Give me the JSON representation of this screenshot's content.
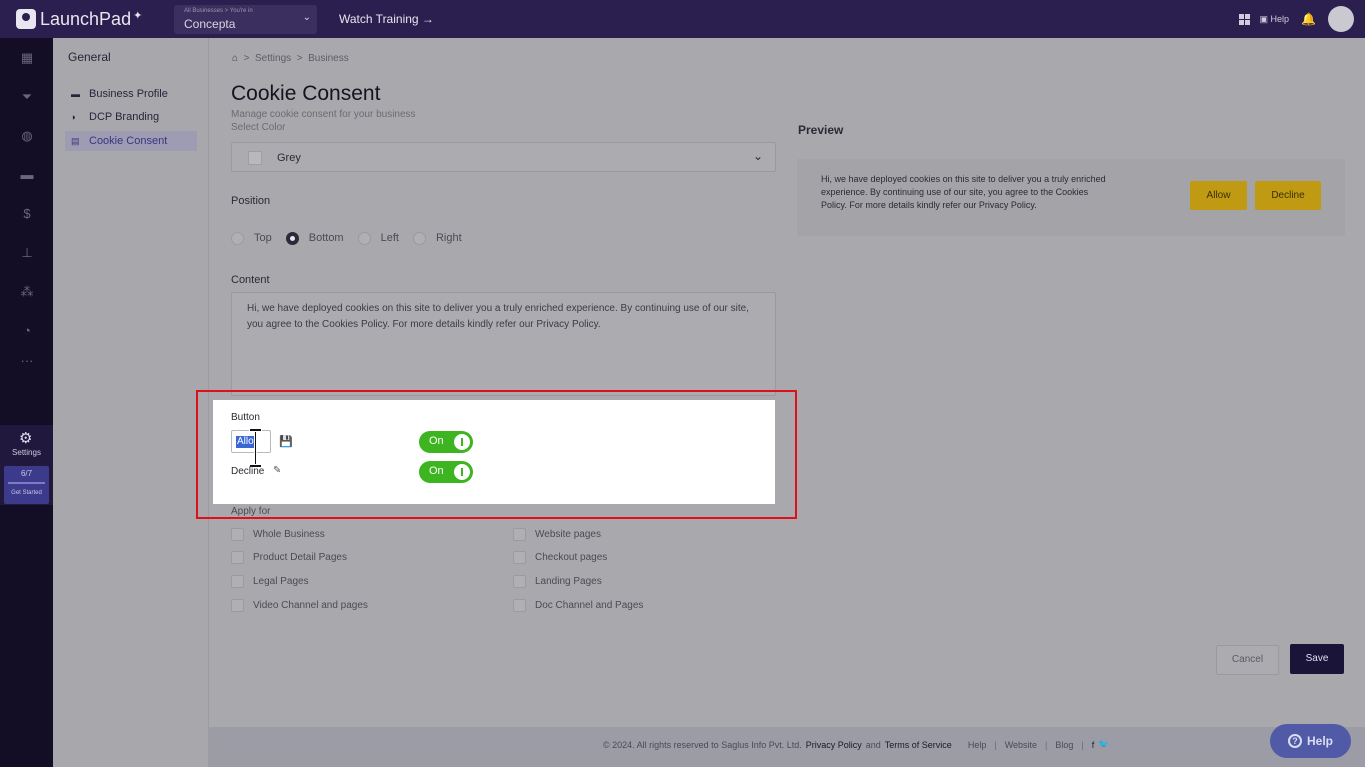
{
  "app": {
    "name": "LaunchPad"
  },
  "topbar": {
    "business_small": "All Businesses > You're in",
    "business_name": "Concepta",
    "watch_training": "Watch Training →",
    "help": "Help"
  },
  "rail": {
    "settings_label": "Settings",
    "progress": "6/7",
    "get_started": "Get Started"
  },
  "subnav": {
    "heading": "General",
    "items": [
      {
        "label": "Business Profile"
      },
      {
        "label": "DCP Branding"
      },
      {
        "label": "Cookie Consent"
      }
    ]
  },
  "breadcrumb": {
    "settings": "Settings",
    "business": "Business"
  },
  "page": {
    "title": "Cookie Consent",
    "subtitle": "Manage cookie consent for your business",
    "select_color_label": "Select Color",
    "select_color_value": "Grey",
    "position_label": "Position",
    "positions": [
      "Top",
      "Bottom",
      "Left",
      "Right"
    ],
    "selected_position": "Bottom",
    "content_label": "Content",
    "content_text": "Hi, we have deployed cookies on this site to deliver you a truly enriched experience. By continuing use of our site, you agree to the Cookies Policy. For more details kindly refer our Privacy Policy.",
    "button_label": "Button",
    "allow_input_value": "Allo",
    "decline_label": "Decline",
    "toggle_on": "On",
    "apply_for_label": "Apply for",
    "apply_left": [
      "Whole Business",
      "Product Detail Pages",
      "Legal Pages",
      "Video Channel and pages"
    ],
    "apply_right": [
      "Website pages",
      "Checkout pages",
      "Landing Pages",
      "Doc Channel and Pages"
    ]
  },
  "preview": {
    "heading": "Preview",
    "text": "Hi, we have deployed cookies on this site to deliver you a truly enriched experience. By continuing use of our site, you agree to the Cookies Policy. For more details kindly refer our Privacy Policy.",
    "allow": "Allow",
    "decline": "Decline"
  },
  "actions": {
    "cancel": "Cancel",
    "save": "Save"
  },
  "footer": {
    "copyright": "©  2024. All rights reserved to Saglus Info Pvt. Ltd.",
    "privacy": "Privacy Policy",
    "and": "and",
    "terms": "Terms of Service",
    "help": "Help",
    "website": "Website",
    "blog": "Blog",
    "sep": "|",
    "facebook": "f",
    "twitter": "🐦"
  },
  "help_button": {
    "label": "Help",
    "glyph": "?"
  },
  "icons": {
    "chevron": "⌄",
    "home": "⌂",
    "gear": "⚙",
    "bell": "🔔",
    "save": "💾",
    "pencil": "✎",
    "crumb_sep": ">"
  },
  "colors": {
    "accent": "#2a1f4e",
    "toggle_green": "#3cb521",
    "preview_button": "#c09a12",
    "highlight": "#e0101a"
  }
}
